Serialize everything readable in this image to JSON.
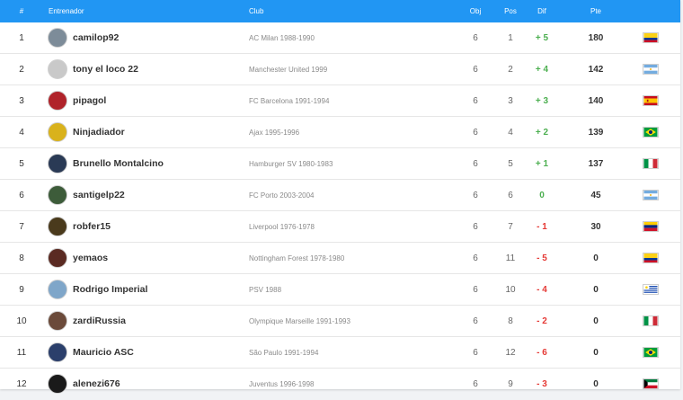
{
  "header": {
    "num": "#",
    "coach": "Entrenador",
    "club": "Club",
    "obj": "Obj",
    "pos": "Pos",
    "dif": "Dif",
    "pts": "Pte"
  },
  "colors": {
    "header_bg": "#2196f3",
    "positive": "#4caf50",
    "negative": "#e53935",
    "zero": "#4caf50"
  },
  "rows": [
    {
      "num": "1",
      "coach": "camilop92",
      "club": "AC Milan 1988-1990",
      "obj": "6",
      "pos": "1",
      "dif": "+ 5",
      "pts": "180",
      "sign": "pos",
      "flag": "colombia",
      "avatar": "#7d8c99"
    },
    {
      "num": "2",
      "coach": "tony el loco 22",
      "club": "Manchester United 1999",
      "obj": "6",
      "pos": "2",
      "dif": "+ 4",
      "pts": "142",
      "sign": "pos",
      "flag": "argentina",
      "avatar": "#c9c9c9"
    },
    {
      "num": "3",
      "coach": "pipagol",
      "club": "FC Barcelona 1991-1994",
      "obj": "6",
      "pos": "3",
      "dif": "+ 3",
      "pts": "140",
      "sign": "pos",
      "flag": "spain",
      "avatar": "#b0232a"
    },
    {
      "num": "4",
      "coach": "Ninjadiador",
      "club": "Ajax 1995-1996",
      "obj": "6",
      "pos": "4",
      "dif": "+ 2",
      "pts": "139",
      "sign": "pos",
      "flag": "brazil",
      "avatar": "#d9b21c"
    },
    {
      "num": "5",
      "coach": "Brunello Montalcino",
      "club": "Hamburger SV 1980-1983",
      "obj": "6",
      "pos": "5",
      "dif": "+ 1",
      "pts": "137",
      "sign": "pos",
      "flag": "italy",
      "avatar": "#2a3a55"
    },
    {
      "num": "6",
      "coach": "santigelp22",
      "club": "FC Porto 2003-2004",
      "obj": "6",
      "pos": "6",
      "dif": "0",
      "pts": "45",
      "sign": "zero",
      "flag": "argentina",
      "avatar": "#3d5c3a"
    },
    {
      "num": "7",
      "coach": "robfer15",
      "club": "Liverpool 1976-1978",
      "obj": "6",
      "pos": "7",
      "dif": "- 1",
      "pts": "30",
      "sign": "neg",
      "flag": "venezuela",
      "avatar": "#4a3a1c"
    },
    {
      "num": "8",
      "coach": "yemaos",
      "club": "Nottingham Forest 1978-1980",
      "obj": "6",
      "pos": "11",
      "dif": "- 5",
      "pts": "0",
      "sign": "neg",
      "flag": "colombia",
      "avatar": "#5a2a22"
    },
    {
      "num": "9",
      "coach": "Rodrigo Imperial",
      "club": "PSV 1988",
      "obj": "6",
      "pos": "10",
      "dif": "- 4",
      "pts": "0",
      "sign": "neg",
      "flag": "uruguay",
      "avatar": "#7fa6c9"
    },
    {
      "num": "10",
      "coach": "zardiRussia",
      "club": "Olympique Marseille 1991-1993",
      "obj": "6",
      "pos": "8",
      "dif": "- 2",
      "pts": "0",
      "sign": "neg",
      "flag": "italy",
      "avatar": "#6b4a3a"
    },
    {
      "num": "11",
      "coach": "Mauricio ASC",
      "club": "São Paulo 1991-1994",
      "obj": "6",
      "pos": "12",
      "dif": "- 6",
      "pts": "0",
      "sign": "neg",
      "flag": "brazil",
      "avatar": "#2b3f6b"
    },
    {
      "num": "12",
      "coach": "alenezi676",
      "club": "Juventus 1996-1998",
      "obj": "6",
      "pos": "9",
      "dif": "- 3",
      "pts": "0",
      "sign": "neg",
      "flag": "kuwait",
      "avatar": "#1a1a1a"
    }
  ]
}
